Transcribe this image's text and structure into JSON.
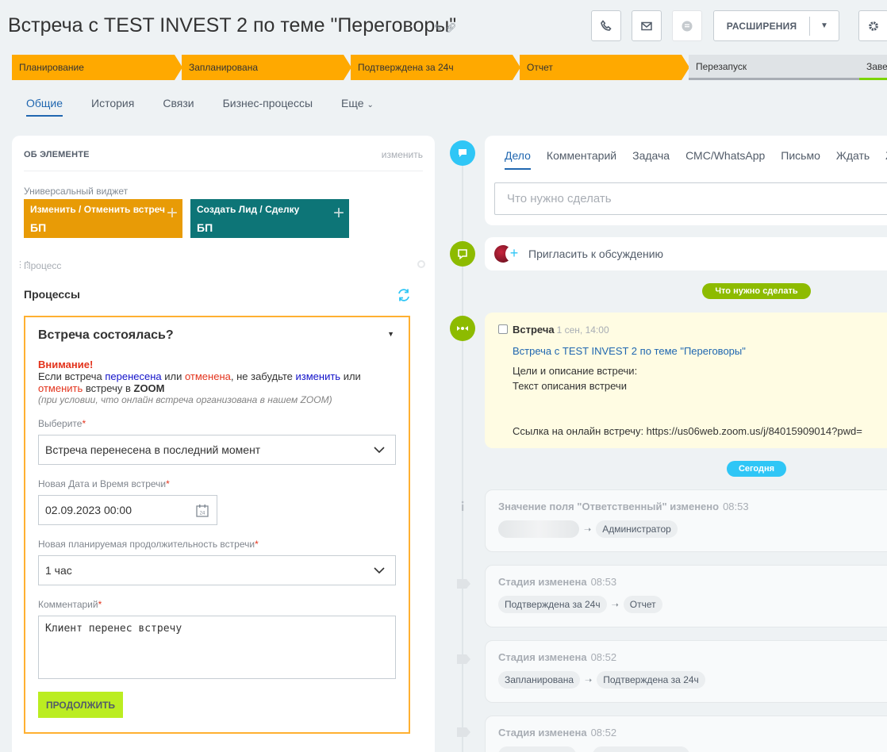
{
  "header": {
    "title": "Встреча с TEST INVEST 2 по теме \"Переговоры\"",
    "extensions_label": "РАСШИРЕНИЯ",
    "icons": [
      "pencil-icon",
      "link-icon",
      "phone-icon",
      "mail-icon",
      "chat-icon",
      "gear-icon"
    ]
  },
  "stages": [
    {
      "label": "Планирование",
      "state": "active"
    },
    {
      "label": "Запланирована",
      "state": "active"
    },
    {
      "label": "Подтверждена за 24ч",
      "state": "active"
    },
    {
      "label": "Отчет",
      "state": "active"
    },
    {
      "label": "Перезапуск",
      "state": "inactive"
    },
    {
      "label": "Заверш",
      "state": "final"
    }
  ],
  "tabs": [
    "Общие",
    "История",
    "Связи",
    "Бизнес-процессы",
    "Еще"
  ],
  "left": {
    "section_title": "ОБ ЭЛЕМЕНТЕ",
    "edit_label": "изменить",
    "widget_label": "Универсальный виджет",
    "widgets": [
      {
        "title": "Изменить / Отменить встречу",
        "sub": "БП",
        "color": "#e89b06"
      },
      {
        "title": "Создать Лид / Сделку",
        "sub": "БП",
        "color": "#0d7577"
      }
    ],
    "process_label": "Процесс",
    "processes_title": "Процессы"
  },
  "bp": {
    "title": "Встреча состоялась?",
    "warn_head": "Внимание!",
    "warn_1": "Если встреча ",
    "warn_moved": "перенесена",
    "warn_2": " или ",
    "warn_cancelled": "отменена",
    "warn_3": ", не забудьте ",
    "warn_change": "изменить",
    "warn_4": " или",
    "warn_cancel": "отменить",
    "warn_5": " встречу в ",
    "warn_zoom": "ZOOM",
    "warn_hint": "(при условии, что онлайн встреча организована в нашем ZOOM)",
    "f1_label": "Выберите",
    "f1_value": "Встреча перенесена в последний момент",
    "f2_label": "Новая Дата и Время встречи",
    "f2_value": "02.09.2023 00:00",
    "f3_label": "Новая планируемая продолжительность встречи",
    "f3_value": "1 час",
    "f4_label": "Комментарий",
    "f4_value": "Клиент перенес встречу",
    "submit": "ПРОДОЛЖИТЬ"
  },
  "timeline": {
    "activity_tabs": [
      "Дело",
      "Комментарий",
      "Задача",
      "СМС/WhatsApp",
      "Письмо",
      "Ждать",
      "Z"
    ],
    "activity_placeholder": "Что нужно сделать",
    "invite": "Пригласить к обсуждению",
    "todo_pill": "Что нужно сделать",
    "meeting": {
      "title": "Встреча",
      "time": "1 сен, 14:00",
      "link": "Встреча с TEST INVEST 2 по теме \"Переговоры\"",
      "desc_1": "Цели и описание встречи:",
      "desc_2": "Текст описания встречи",
      "url": "Ссылка на онлайн встречу: https://us06web.zoom.us/j/84015909014?pwd="
    },
    "today_pill": "Сегодня",
    "history": [
      {
        "title": "Значение поля \"Ответственный\" изменено",
        "time": "08:53",
        "from": "",
        "to": "Администратор"
      },
      {
        "title": "Стадия изменена",
        "time": "08:53",
        "from": "Подтверждена за 24ч",
        "to": "Отчет"
      },
      {
        "title": "Стадия изменена",
        "time": "08:52",
        "from": "Запланирована",
        "to": "Подтверждена за 24ч"
      },
      {
        "title": "Стадия изменена",
        "time": "08:52"
      }
    ]
  },
  "colors": {
    "accent": "#2067b0",
    "stage_active": "#ffa900",
    "timeline_blue": "#2fc6f6",
    "timeline_green": "#8dbb00",
    "submit": "#bbed21",
    "bp_border": "#ffb031"
  }
}
